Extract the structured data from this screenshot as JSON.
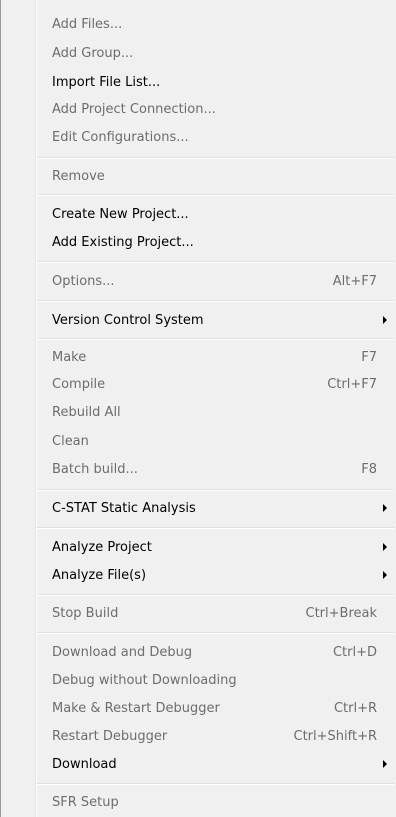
{
  "menu": {
    "items": [
      {
        "label": "Add Files...",
        "shortcut": "",
        "submenu": false,
        "enabled": false
      },
      {
        "label": "Add Group...",
        "shortcut": "",
        "submenu": false,
        "enabled": false
      },
      {
        "label": "Import File List...",
        "shortcut": "",
        "submenu": false,
        "enabled": true
      },
      {
        "label": "Add Project Connection...",
        "shortcut": "",
        "submenu": false,
        "enabled": false
      },
      {
        "label": "Edit Configurations...",
        "shortcut": "",
        "submenu": false,
        "enabled": false
      },
      {
        "label": "Remove",
        "shortcut": "",
        "submenu": false,
        "enabled": false
      },
      {
        "label": "Create New Project...",
        "shortcut": "",
        "submenu": false,
        "enabled": true
      },
      {
        "label": "Add Existing Project...",
        "shortcut": "",
        "submenu": false,
        "enabled": true
      },
      {
        "label": "Options...",
        "shortcut": "Alt+F7",
        "submenu": false,
        "enabled": false
      },
      {
        "label": "Version Control System",
        "shortcut": "",
        "submenu": true,
        "enabled": true
      },
      {
        "label": "Make",
        "shortcut": "F7",
        "submenu": false,
        "enabled": false
      },
      {
        "label": "Compile",
        "shortcut": "Ctrl+F7",
        "submenu": false,
        "enabled": false
      },
      {
        "label": "Rebuild All",
        "shortcut": "",
        "submenu": false,
        "enabled": false
      },
      {
        "label": "Clean",
        "shortcut": "",
        "submenu": false,
        "enabled": false
      },
      {
        "label": "Batch build...",
        "shortcut": "F8",
        "submenu": false,
        "enabled": false
      },
      {
        "label": "C-STAT Static Analysis",
        "shortcut": "",
        "submenu": true,
        "enabled": true
      },
      {
        "label": "Analyze Project",
        "shortcut": "",
        "submenu": true,
        "enabled": true
      },
      {
        "label": "Analyze File(s)",
        "shortcut": "",
        "submenu": true,
        "enabled": true
      },
      {
        "label": "Stop Build",
        "shortcut": "Ctrl+Break",
        "submenu": false,
        "enabled": false
      },
      {
        "label": "Download and Debug",
        "shortcut": "Ctrl+D",
        "submenu": false,
        "enabled": false
      },
      {
        "label": "Debug without Downloading",
        "shortcut": "",
        "submenu": false,
        "enabled": false
      },
      {
        "label": "Make & Restart Debugger",
        "shortcut": "Ctrl+R",
        "submenu": false,
        "enabled": false
      },
      {
        "label": "Restart Debugger",
        "shortcut": "Ctrl+Shift+R",
        "submenu": false,
        "enabled": false
      },
      {
        "label": "Download",
        "shortcut": "",
        "submenu": true,
        "enabled": true
      },
      {
        "label": "SFR Setup",
        "shortcut": "",
        "submenu": false,
        "enabled": false
      }
    ]
  }
}
